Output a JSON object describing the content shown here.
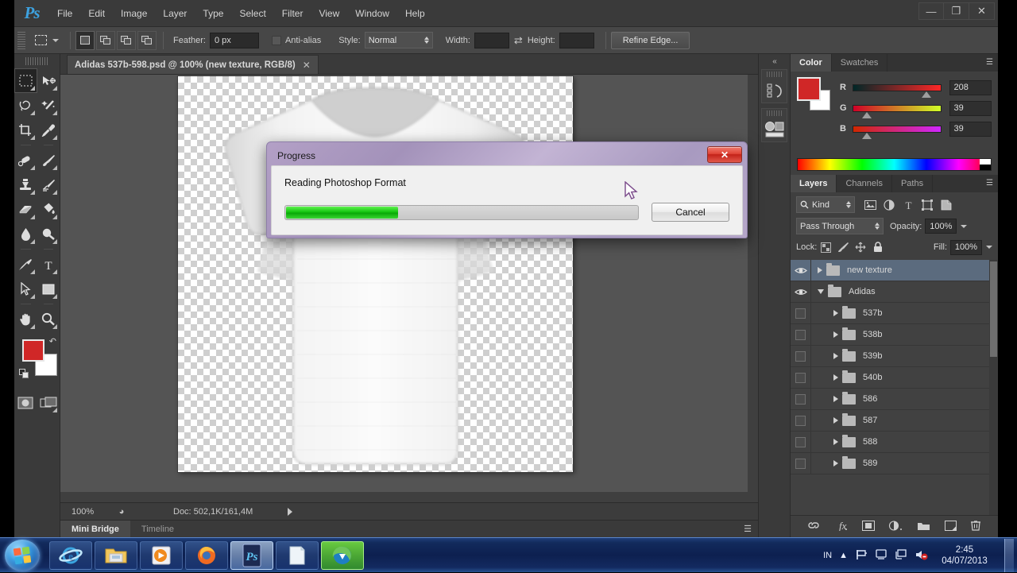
{
  "app": {
    "name": "Adobe Photoshop",
    "logo": "Ps"
  },
  "menubar": {
    "items": [
      "File",
      "Edit",
      "Image",
      "Layer",
      "Type",
      "Select",
      "Filter",
      "View",
      "Window",
      "Help"
    ],
    "window_controls": {
      "minimize": "–",
      "restore": "❐",
      "close": "✕"
    }
  },
  "options_bar": {
    "feather_label": "Feather:",
    "feather_value": "0 px",
    "antialias_label": "Anti-alias",
    "style_label": "Style:",
    "style_value": "Normal",
    "width_label": "Width:",
    "width_value": "",
    "height_label": "Height:",
    "height_value": "",
    "swap_icon": "swap-dimensions-icon",
    "refine_edge": "Refine Edge..."
  },
  "toolbox": {
    "tools": [
      {
        "name": "rectangular-marquee",
        "active": true
      },
      {
        "name": "move",
        "active": false
      },
      {
        "name": "lasso",
        "active": false
      },
      {
        "name": "magic-wand",
        "active": false
      },
      {
        "name": "crop",
        "active": false
      },
      {
        "name": "eyedropper",
        "active": false
      },
      {
        "name": "spot-healing-brush",
        "active": false
      },
      {
        "name": "brush",
        "active": false
      },
      {
        "name": "clone-stamp",
        "active": false
      },
      {
        "name": "history-brush",
        "active": false
      },
      {
        "name": "eraser",
        "active": false
      },
      {
        "name": "paint-bucket",
        "active": false
      },
      {
        "name": "blur",
        "active": false
      },
      {
        "name": "dodge",
        "active": false
      },
      {
        "name": "pen",
        "active": false
      },
      {
        "name": "horizontal-type",
        "active": false
      },
      {
        "name": "path-selection",
        "active": false
      },
      {
        "name": "rectangle-shape",
        "active": false
      },
      {
        "name": "hand",
        "active": false
      },
      {
        "name": "zoom",
        "active": false
      }
    ],
    "foreground_color": "#D02727",
    "background_color": "#FFFFFF",
    "quick_mask": "edit-in-quick-mask-mode",
    "screen_mode": "change-screen-mode"
  },
  "document": {
    "tab_title": "Adidas 537b-598.psd @ 100% (new texture, RGB/8)",
    "close_glyph": "✕"
  },
  "status_bar": {
    "zoom": "100%",
    "doc_info": "Doc: 502,1K/161,4M"
  },
  "bottom_tabs": {
    "items": [
      "Mini Bridge",
      "Timeline"
    ],
    "active": "Mini Bridge"
  },
  "color_panel": {
    "tabs": [
      "Color",
      "Swatches"
    ],
    "active_tab": "Color",
    "foreground": "#D02727",
    "background": "#FFFFFF",
    "channels": [
      {
        "label": "R",
        "value": "208"
      },
      {
        "label": "G",
        "value": "39"
      },
      {
        "label": "B",
        "value": "39"
      }
    ]
  },
  "layers_panel": {
    "tabs": [
      "Layers",
      "Channels",
      "Paths"
    ],
    "active_tab": "Layers",
    "filter_kind": "Kind",
    "filter_icons": [
      "pixel-layer-filter",
      "adjustment-layer-filter",
      "type-layer-filter",
      "shape-layer-filter",
      "smart-object-filter"
    ],
    "blend_mode": "Pass Through",
    "opacity_label": "Opacity:",
    "opacity_value": "100%",
    "lock_label": "Lock:",
    "lock_icons": [
      "lock-transparent-pixels",
      "lock-image-pixels",
      "lock-position",
      "lock-all"
    ],
    "fill_label": "Fill:",
    "fill_value": "100%",
    "rows": [
      {
        "name": "new texture",
        "visible": true,
        "expanded": false,
        "indent": 0,
        "selected": true
      },
      {
        "name": "Adidas",
        "visible": true,
        "expanded": true,
        "indent": 0,
        "selected": false
      },
      {
        "name": "537b",
        "visible": false,
        "expanded": false,
        "indent": 1,
        "selected": false
      },
      {
        "name": "538b",
        "visible": false,
        "expanded": false,
        "indent": 1,
        "selected": false
      },
      {
        "name": "539b",
        "visible": false,
        "expanded": false,
        "indent": 1,
        "selected": false
      },
      {
        "name": "540b",
        "visible": false,
        "expanded": false,
        "indent": 1,
        "selected": false
      },
      {
        "name": "586",
        "visible": false,
        "expanded": false,
        "indent": 1,
        "selected": false
      },
      {
        "name": "587",
        "visible": false,
        "expanded": false,
        "indent": 1,
        "selected": false
      },
      {
        "name": "588",
        "visible": false,
        "expanded": false,
        "indent": 1,
        "selected": false
      },
      {
        "name": "589",
        "visible": false,
        "expanded": false,
        "indent": 1,
        "selected": false
      }
    ],
    "footer_icons": [
      "link-layers",
      "add-layer-style",
      "add-layer-mask",
      "new-adjustment-layer",
      "new-group",
      "new-layer",
      "delete-layer"
    ]
  },
  "dock_icons": [
    "history-panel-icon",
    "adjustments-panel-icon"
  ],
  "progress_dialog": {
    "title": "Progress",
    "message": "Reading Photoshop Format",
    "percent": 32,
    "cancel_label": "Cancel",
    "close_glyph": "✕"
  },
  "taskbar": {
    "start": "start-orb",
    "apps": [
      {
        "name": "internet-explorer",
        "active": false
      },
      {
        "name": "windows-explorer",
        "active": false
      },
      {
        "name": "windows-media-player",
        "active": false
      },
      {
        "name": "mozilla-firefox",
        "active": false
      },
      {
        "name": "adobe-photoshop",
        "active": true,
        "label": "Ps"
      },
      {
        "name": "notepad-app",
        "active": false
      },
      {
        "name": "internet-download-manager",
        "active": false
      }
    ],
    "tray": {
      "language": "IN",
      "icons": [
        "show-hidden-icons",
        "action-center-flag",
        "network-icon",
        "display-icon",
        "volume-muted-icon"
      ],
      "time": "2:45",
      "date": "04/07/2013"
    }
  }
}
